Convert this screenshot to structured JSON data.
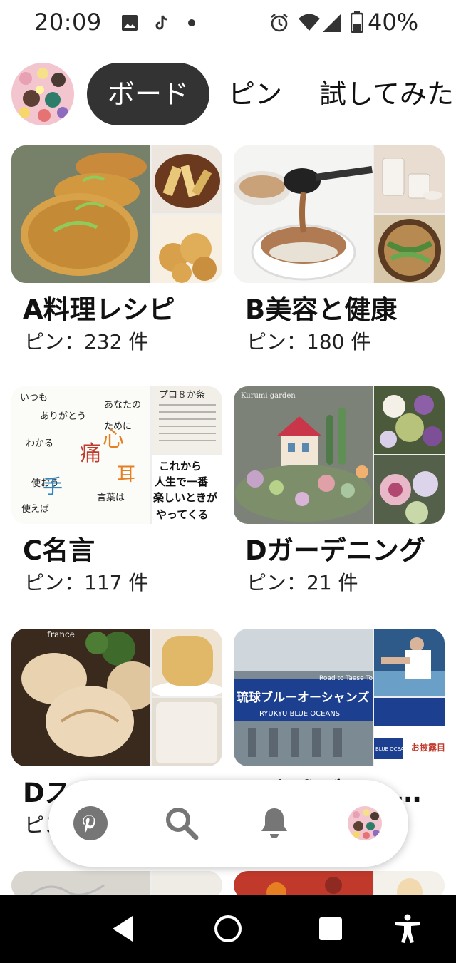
{
  "status_bar": {
    "time": "20:09",
    "battery": "40%",
    "icons": [
      "image-icon",
      "tiktok-icon",
      "dot-icon",
      "alarm-icon",
      "wifi-icon",
      "signal-icon",
      "battery-icon"
    ]
  },
  "profile": {
    "avatar": "profile-avatar",
    "tabs": [
      {
        "label": "ボード",
        "active": true
      },
      {
        "label": "ピン",
        "active": false
      },
      {
        "label": "試してみた",
        "active": false
      }
    ]
  },
  "boards": [
    {
      "title": "A料理レシピ",
      "count": "ピン：232 件"
    },
    {
      "title": "B美容と健康",
      "count": "ピン：180 件"
    },
    {
      "title": "C名言",
      "count": "ピン：117 件"
    },
    {
      "title": "Dガーデニング",
      "count": "ピン：21 件"
    },
    {
      "title": "Dスイーツとパン",
      "count": "ピン：…"
    },
    {
      "title": "E琉球ブルーオーシャンズ",
      "count": ""
    }
  ],
  "image_text": {
    "proverb_tag": "プロ８か条",
    "proverb_lines": [
      "これから",
      "人生で一番",
      "楽しいときが",
      "やってくる"
    ],
    "garden_sign": "Kurumi garden",
    "bread_label": "france",
    "banner_top": "Road to Taese Town",
    "banner_main": "琉球ブルーオーシャンズ",
    "banner_sub": "RYUKYU BLUE OCEANS",
    "event_text": "お披露目",
    "ryukyu_small": "BLUE OCEANS"
  },
  "nav": {
    "items": [
      "pinterest-home-icon",
      "search-icon",
      "bell-icon",
      "profile-avatar"
    ]
  },
  "colors": {
    "active_tab_bg": "#333333",
    "nav_icon": "#767676",
    "pinterest_red": "#767676"
  }
}
